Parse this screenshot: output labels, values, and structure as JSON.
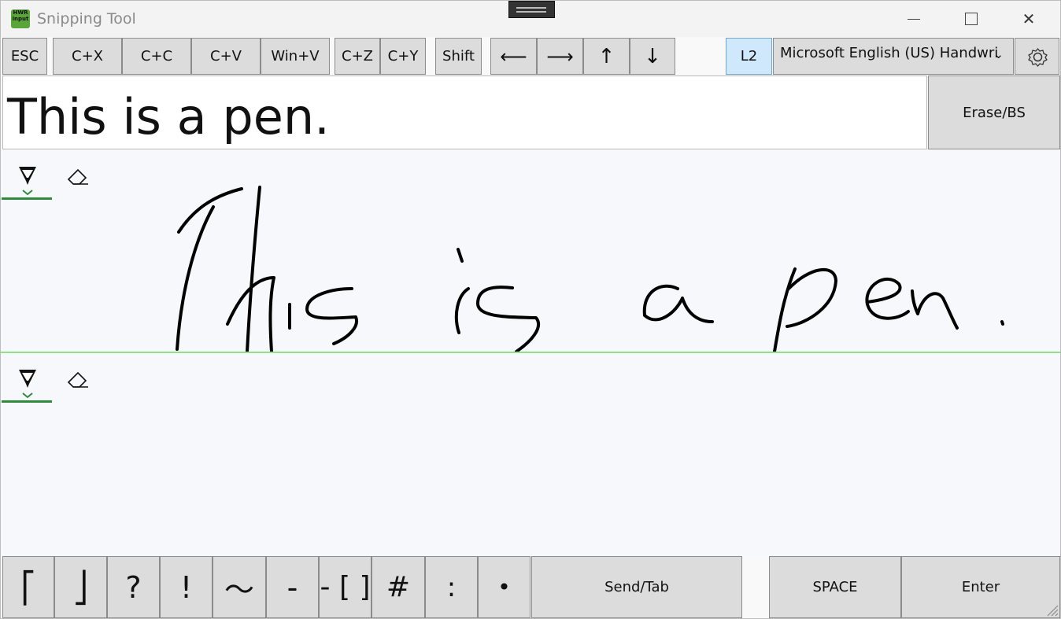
{
  "window": {
    "title": "Snipping Tool",
    "icon_text_top": "HWR",
    "icon_text_bottom": "input"
  },
  "toolbar": {
    "esc": "ESC",
    "cut": "C+X",
    "copy": "C+C",
    "paste": "C+V",
    "win_v": "Win+V",
    "undo": "C+Z",
    "redo": "C+Y",
    "shift": "Shift",
    "left_arrow": "⟵",
    "right_arrow": "⟶",
    "up_arrow": "↑",
    "down_arrow": "↓",
    "l2": "L2",
    "language": "Microsoft English (US) Handwri",
    "language_chevron": "⌄"
  },
  "output": {
    "text": "This is a pen.",
    "erase_label": "Erase/BS"
  },
  "bottom": {
    "keys": [
      "⎡",
      "⎦",
      "?",
      "!",
      "〜",
      "-",
      "- [ ]",
      "#",
      ":",
      "•"
    ],
    "send_tab": "Send/Tab",
    "space": "SPACE",
    "enter": "Enter"
  },
  "colors": {
    "accent_green": "#2e8b3c",
    "key_gray": "#dcdcdc",
    "active_blue": "#cfe8fb",
    "ink": "#000000"
  },
  "icons": [
    "pen-icon",
    "eraser-icon",
    "gear-icon",
    "close-icon",
    "minimize-icon",
    "maximize-icon"
  ]
}
